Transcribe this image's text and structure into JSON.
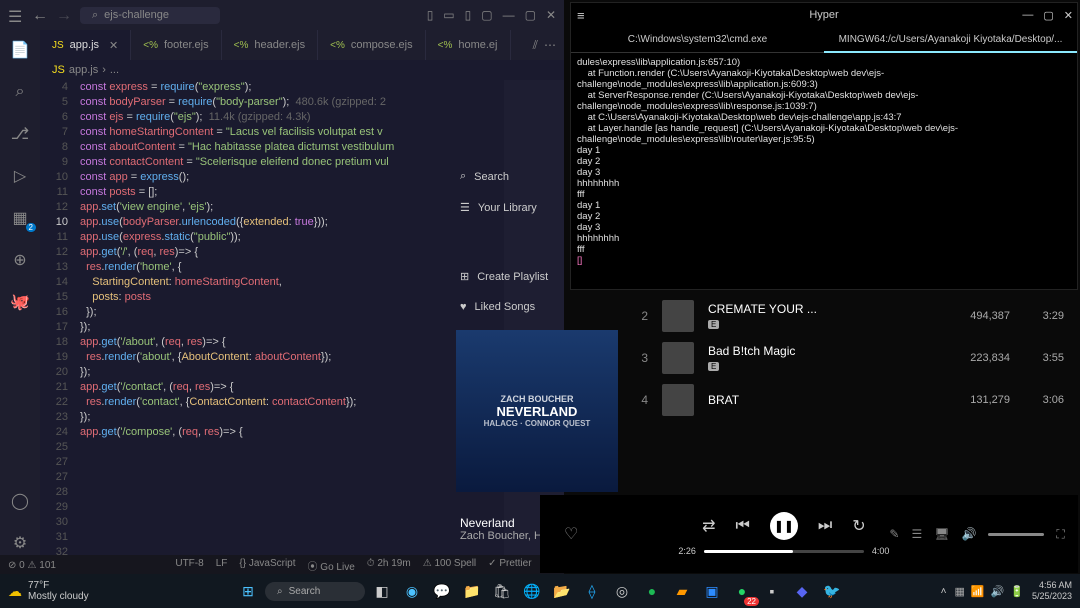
{
  "vscode": {
    "search_placeholder": "ejs-challenge",
    "tabs": [
      {
        "icon": "JS",
        "label": "app.js",
        "active": true
      },
      {
        "icon": "<%",
        "label": "footer.ejs"
      },
      {
        "icon": "<%",
        "label": "header.ejs"
      },
      {
        "icon": "<%",
        "label": "compose.ejs"
      },
      {
        "icon": "<%",
        "label": "home.ej"
      }
    ],
    "breadcrumb_file": "app.js",
    "breadcrumb_more": "...",
    "activity_badge": "2",
    "code": {
      "lines": [
        {
          "n": 4,
          "html": "<span class='kw'>const</span> <span class='var'>express</span> = <span class='fn'>require</span>(<span class='str'>\"express\"</span>);"
        },
        {
          "n": 5,
          "html": "<span class='kw'>const</span> <span class='var'>bodyParser</span> = <span class='fn'>require</span>(<span class='str'>\"body-parser\"</span>);  <span class='hint'>480.6k (gzipped: 2</span>"
        },
        {
          "n": 6,
          "html": "<span class='kw'>const</span> <span class='var'>ejs</span> = <span class='fn'>require</span>(<span class='str'>\"ejs\"</span>);  <span class='hint'>11.4k (gzipped: 4.3k)</span>"
        },
        {
          "n": 7,
          "html": ""
        },
        {
          "n": 8,
          "html": "<span class='kw'>const</span> <span class='var'>homeStartingContent</span> = <span class='str'>\"Lacus vel facilisis volutpat est v</span>"
        },
        {
          "n": 9,
          "html": "<span class='kw'>const</span> <span class='var'>aboutContent</span> = <span class='str'>\"Hac habitasse platea dictumst vestibulum</span>"
        },
        {
          "n": 10,
          "html": "<span class='kw'>const</span> <span class='var'>contactContent</span> = <span class='str'>\"Scelerisque eleifend donec pretium vul</span>"
        },
        {
          "n": 11,
          "html": ""
        },
        {
          "n": 12,
          "html": "<span class='kw'>const</span> <span class='var'>app</span> = <span class='fn'>express</span>();"
        },
        {
          "n": 10,
          "active": true,
          "html": "<span class='kw'>const</span> <span class='var'>posts</span> = [];"
        },
        {
          "n": 11,
          "html": ""
        },
        {
          "n": 12,
          "html": "<span class='var'>app</span>.<span class='fn'>set</span>(<span class='str'>'view engine'</span>, <span class='str'>'ejs'</span>);"
        },
        {
          "n": 13,
          "html": ""
        },
        {
          "n": 14,
          "html": "<span class='var'>app</span>.<span class='fn'>use</span>(<span class='var'>bodyParser</span>.<span class='fn'>urlencoded</span>({<span class='prop'>extended</span>: <span class='kw'>true</span>}));"
        },
        {
          "n": 15,
          "html": "<span class='var'>app</span>.<span class='fn'>use</span>(<span class='var'>express</span>.<span class='fn'>static</span>(<span class='str'>\"public\"</span>));"
        },
        {
          "n": 16,
          "html": ""
        },
        {
          "n": 17,
          "html": "<span class='var'>app</span>.<span class='fn'>get</span>(<span class='str'>'/'</span>, (<span class='var'>req</span>, <span class='var'>res</span>)=&gt; {"
        },
        {
          "n": 18,
          "html": "  <span class='var'>res</span>.<span class='fn'>render</span>(<span class='str'>'home'</span>, {"
        },
        {
          "n": 19,
          "html": "    <span class='prop'>StartingContent</span>: <span class='var'>homeStartingContent</span>,"
        },
        {
          "n": 20,
          "html": "    <span class='prop'>posts</span>: <span class='var'>posts</span>"
        },
        {
          "n": 21,
          "html": "  });"
        },
        {
          "n": 22,
          "html": "});"
        },
        {
          "n": 23,
          "html": ""
        },
        {
          "n": 24,
          "html": "<span class='var'>app</span>.<span class='fn'>get</span>(<span class='str'>'/about'</span>, (<span class='var'>req</span>, <span class='var'>res</span>)=&gt; {"
        },
        {
          "n": 25,
          "html": "  <span class='var'>res</span>.<span class='fn'>render</span>(<span class='str'>'about'</span>, {<span class='prop'>AboutContent</span>: <span class='var'>aboutContent</span>});"
        },
        {
          "n": 27,
          "html": "});"
        },
        {
          "n": 27,
          "html": ""
        },
        {
          "n": 28,
          "html": "<span class='var'>app</span>.<span class='fn'>get</span>(<span class='str'>'/contact'</span>, (<span class='var'>req</span>, <span class='var'>res</span>)=&gt; {"
        },
        {
          "n": 29,
          "html": "  <span class='var'>res</span>.<span class='fn'>render</span>(<span class='str'>'contact'</span>, {<span class='prop'>ContactContent</span>: <span class='var'>contactContent</span>});"
        },
        {
          "n": 30,
          "html": "});"
        },
        {
          "n": 31,
          "html": ""
        },
        {
          "n": 32,
          "html": "<span class='var'>app</span>.<span class='fn'>get</span>(<span class='str'>'/compose'</span>, (<span class='var'>req</span>, <span class='var'>res</span>)=&gt; {"
        }
      ]
    },
    "status": {
      "errors": "0",
      "warnings": "101",
      "encoding": "UTF-8",
      "eol": "LF",
      "lang": "{} JavaScript",
      "golive": "⦿ Go Live",
      "time": "⏱ 2h 19m",
      "spell": "⚠ 100 Spell",
      "prettier": "✓ Prettier"
    }
  },
  "spotify_side": {
    "search": "Search",
    "library": "Your Library",
    "create": "Create Playlist",
    "liked": "Liked Songs"
  },
  "album": {
    "artist": "ZACH BOUCHER",
    "title": "NEVERLAND",
    "sub": "HALACG · CONNOR QUEST"
  },
  "hyper": {
    "title": "Hyper",
    "tab1": "C:\\Windows\\system32\\cmd.exe",
    "tab2": "MINGW64:/c/Users/Ayanakoji Kiyotaka/Desktop/...",
    "lines": [
      "dules\\express\\lib\\application.js:657:10)",
      "    at Function.render (C:\\Users\\Ayanakoji-Kiyotaka\\Desktop\\web dev\\ejs-challenge\\node_modules\\express\\lib\\application.js:609:3)",
      "    at ServerResponse.render (C:\\Users\\Ayanakoji-Kiyotaka\\Desktop\\web dev\\ejs-challenge\\node_modules\\express\\lib\\response.js:1039:7)",
      "    at C:\\Users\\Ayanakoji-Kiyotaka\\Desktop\\web dev\\ejs-challenge\\app.js:43:7",
      "    at Layer.handle [as handle_request] (C:\\Users\\Ayanakoji-Kiyotaka\\Desktop\\web dev\\ejs-challenge\\node_modules\\express\\lib\\router\\layer.js:95:5)",
      "day 1",
      "day 2",
      "day 3",
      "hhhhhhhh",
      "fff",
      "day 1",
      "day 2",
      "day 3",
      "hhhhhhhh",
      "fff"
    ],
    "prompt": "[]"
  },
  "music": {
    "rows": [
      {
        "n": "2",
        "title": "CREMATE YOUR ...",
        "explicit": "E",
        "plays": "494,387",
        "dur": "3:29"
      },
      {
        "n": "3",
        "title": "Bad B!tch Magic",
        "explicit": "E",
        "plays": "223,834",
        "dur": "3:55"
      },
      {
        "n": "4",
        "title": "BRAT",
        "explicit": "",
        "plays": "131,279",
        "dur": "3:06"
      }
    ]
  },
  "player": {
    "now_title": "Neverland",
    "now_artist": "Zach Boucher, Halacg,...",
    "cur": "2:26",
    "total": "4:00"
  },
  "taskbar": {
    "temp": "77°F",
    "cond": "Mostly cloudy",
    "search": "Search",
    "time": "4:56 AM",
    "date": "5/25/2023",
    "whatsapp_badge": "22"
  }
}
